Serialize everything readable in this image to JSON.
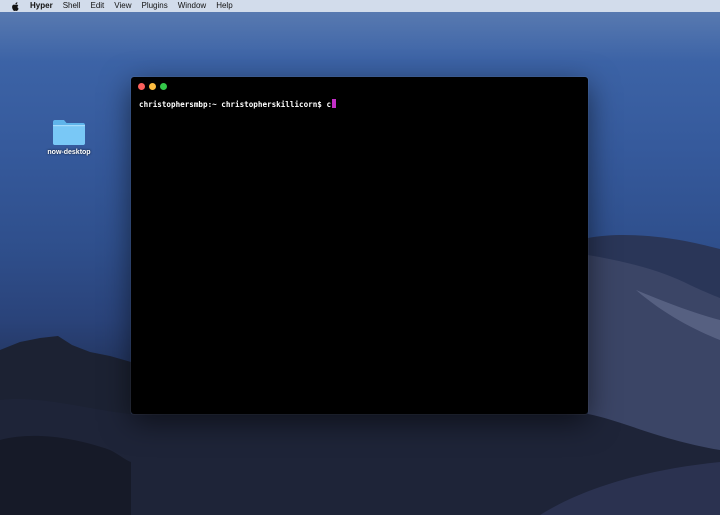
{
  "menubar": {
    "apple_icon": "apple-logo-icon",
    "app_name": "Hyper",
    "items": [
      "Shell",
      "Edit",
      "View",
      "Plugins",
      "Window",
      "Help"
    ]
  },
  "desktop": {
    "folder": {
      "label": "now-desktop",
      "icon": "folder-icon",
      "color": "#6ec3f4"
    }
  },
  "terminal": {
    "traffic_lights": {
      "close_color": "#fc605c",
      "minimize_color": "#fdbc40",
      "zoom_color": "#34c84a"
    },
    "prompt": "christophersmbp:~ christopherskillicorn$",
    "input": "c",
    "cursor_color": "#c32fc7"
  }
}
